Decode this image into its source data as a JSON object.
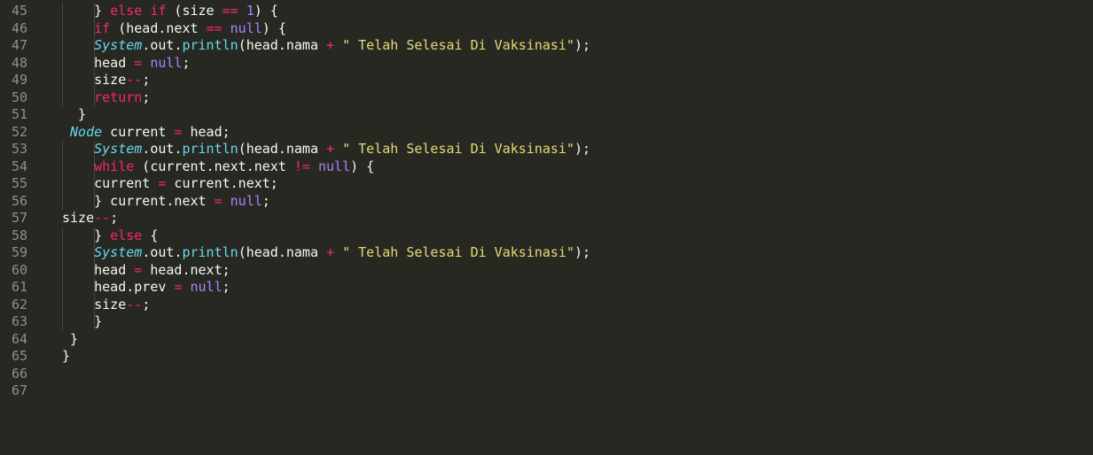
{
  "editor": {
    "colors": {
      "background": "#272822",
      "gutter_text": "#90908a",
      "keyword": "#f92672",
      "literal": "#ae81ff",
      "string": "#e6db74",
      "type": "#66d9ef",
      "default": "#f8f8f2"
    },
    "lines": [
      {
        "number": "45",
        "tokens": [
          {
            "t": "    "
          },
          {
            "t": "} "
          },
          {
            "t": "else",
            "c": "kw"
          },
          {
            "t": " "
          },
          {
            "t": "if",
            "c": "kw"
          },
          {
            "t": " (size "
          },
          {
            "t": "==",
            "c": "op"
          },
          {
            "t": " "
          },
          {
            "t": "1",
            "c": "lit"
          },
          {
            "t": ") {"
          }
        ]
      },
      {
        "number": "46",
        "tokens": [
          {
            "t": "    "
          },
          {
            "t": "if",
            "c": "kw"
          },
          {
            "t": " (head.next "
          },
          {
            "t": "==",
            "c": "op"
          },
          {
            "t": " "
          },
          {
            "t": "null",
            "c": "lit"
          },
          {
            "t": ") {"
          }
        ]
      },
      {
        "number": "47",
        "tokens": [
          {
            "t": "    "
          },
          {
            "t": "System",
            "c": "type"
          },
          {
            "t": "."
          },
          {
            "t": "out"
          },
          {
            "t": "."
          },
          {
            "t": "println",
            "c": "fn"
          },
          {
            "t": "(head.nama "
          },
          {
            "t": "+",
            "c": "op"
          },
          {
            "t": " "
          },
          {
            "t": "\" Telah Selesai Di Vaksinasi\"",
            "c": "str"
          },
          {
            "t": ");"
          }
        ]
      },
      {
        "number": "48",
        "tokens": [
          {
            "t": "    "
          },
          {
            "t": "head "
          },
          {
            "t": "=",
            "c": "op"
          },
          {
            "t": " "
          },
          {
            "t": "null",
            "c": "lit"
          },
          {
            "t": ";"
          }
        ]
      },
      {
        "number": "49",
        "tokens": [
          {
            "t": "    "
          },
          {
            "t": "size"
          },
          {
            "t": "--",
            "c": "op"
          },
          {
            "t": ";"
          }
        ]
      },
      {
        "number": "50",
        "tokens": [
          {
            "t": "    "
          },
          {
            "t": "return",
            "c": "kw"
          },
          {
            "t": ";"
          }
        ]
      },
      {
        "number": "51",
        "tokens": [
          {
            "t": "  }"
          }
        ]
      },
      {
        "number": "52",
        "tokens": [
          {
            "t": " "
          },
          {
            "t": "Node",
            "c": "type"
          },
          {
            "t": " current "
          },
          {
            "t": "=",
            "c": "op"
          },
          {
            "t": " head;"
          }
        ]
      },
      {
        "number": "53",
        "tokens": [
          {
            "t": "    "
          },
          {
            "t": "System",
            "c": "type"
          },
          {
            "t": "."
          },
          {
            "t": "out"
          },
          {
            "t": "."
          },
          {
            "t": "println",
            "c": "fn"
          },
          {
            "t": "(head.nama "
          },
          {
            "t": "+",
            "c": "op"
          },
          {
            "t": " "
          },
          {
            "t": "\" Telah Selesai Di Vaksinasi\"",
            "c": "str"
          },
          {
            "t": ");"
          }
        ]
      },
      {
        "number": "54",
        "tokens": [
          {
            "t": "    "
          },
          {
            "t": "while",
            "c": "kw"
          },
          {
            "t": " (current.next.next "
          },
          {
            "t": "!=",
            "c": "op"
          },
          {
            "t": " "
          },
          {
            "t": "null",
            "c": "lit"
          },
          {
            "t": ") {"
          }
        ]
      },
      {
        "number": "55",
        "tokens": [
          {
            "t": "    "
          },
          {
            "t": "current "
          },
          {
            "t": "=",
            "c": "op"
          },
          {
            "t": " current.next;"
          }
        ]
      },
      {
        "number": "56",
        "tokens": [
          {
            "t": "    "
          },
          {
            "t": "} current.next "
          },
          {
            "t": "=",
            "c": "op"
          },
          {
            "t": " "
          },
          {
            "t": "null",
            "c": "lit"
          },
          {
            "t": ";"
          }
        ]
      },
      {
        "number": "57",
        "tokens": [
          {
            "t": "size"
          },
          {
            "t": "--",
            "c": "op"
          },
          {
            "t": ";"
          }
        ]
      },
      {
        "number": "58",
        "tokens": [
          {
            "t": "    "
          },
          {
            "t": "} "
          },
          {
            "t": "else",
            "c": "kw"
          },
          {
            "t": " {"
          }
        ]
      },
      {
        "number": "59",
        "tokens": [
          {
            "t": "    "
          },
          {
            "t": "System",
            "c": "type"
          },
          {
            "t": "."
          },
          {
            "t": "out"
          },
          {
            "t": "."
          },
          {
            "t": "println",
            "c": "fn"
          },
          {
            "t": "(head.nama "
          },
          {
            "t": "+",
            "c": "op"
          },
          {
            "t": " "
          },
          {
            "t": "\" Telah Selesai Di Vaksinasi\"",
            "c": "str"
          },
          {
            "t": ");"
          }
        ]
      },
      {
        "number": "60",
        "tokens": [
          {
            "t": "    "
          },
          {
            "t": "head "
          },
          {
            "t": "=",
            "c": "op"
          },
          {
            "t": " head.next;"
          }
        ]
      },
      {
        "number": "61",
        "tokens": [
          {
            "t": "    "
          },
          {
            "t": "head.prev "
          },
          {
            "t": "=",
            "c": "op"
          },
          {
            "t": " "
          },
          {
            "t": "null",
            "c": "lit"
          },
          {
            "t": ";"
          }
        ]
      },
      {
        "number": "62",
        "tokens": [
          {
            "t": "    "
          },
          {
            "t": "size"
          },
          {
            "t": "--",
            "c": "op"
          },
          {
            "t": ";"
          }
        ]
      },
      {
        "number": "63",
        "tokens": [
          {
            "t": "    "
          },
          {
            "t": "}"
          }
        ]
      },
      {
        "number": "64",
        "tokens": [
          {
            "t": " }"
          }
        ]
      },
      {
        "number": "65",
        "tokens": [
          {
            "t": "}"
          }
        ]
      },
      {
        "number": "66",
        "tokens": []
      },
      {
        "number": "67",
        "tokens": []
      }
    ]
  }
}
